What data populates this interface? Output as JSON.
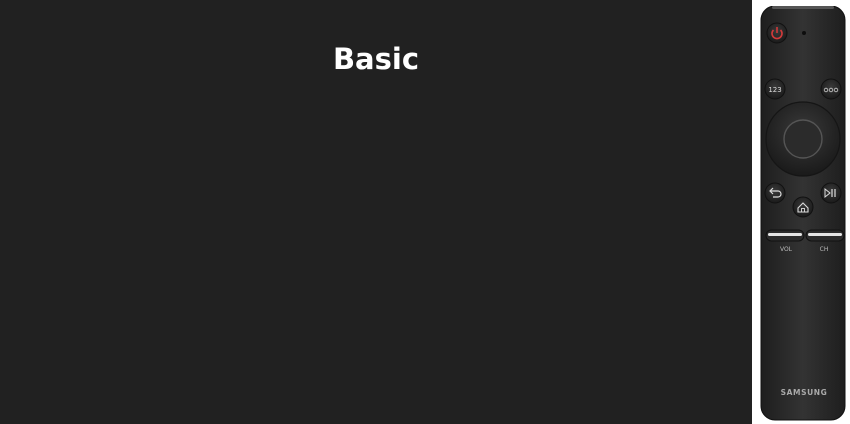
{
  "screen": {
    "title": "Basic",
    "background_color": "#212121"
  },
  "remote": {
    "brand": "SAMSUNG",
    "body_color": "#2a2a2a",
    "power_color": "#d23a3a",
    "buttons": {
      "power": "power-icon",
      "number": "123",
      "color": "color-dots-icon",
      "back": "back-arrow-icon",
      "play_pause": "play-pause-icon",
      "home": "home-icon"
    },
    "rockers": {
      "volume_label": "VOL",
      "channel_label": "CH"
    }
  }
}
